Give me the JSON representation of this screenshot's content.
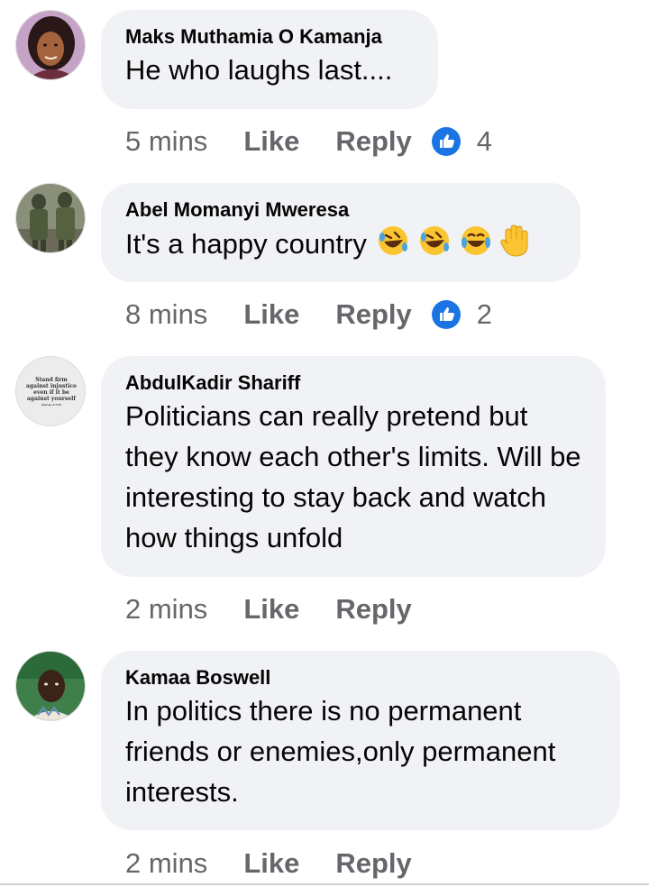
{
  "comments": [
    {
      "author": "Maks Muthamia O Kamanja",
      "text": "He who laughs last....",
      "time": "5 mins",
      "like_label": "Like",
      "reply_label": "Reply",
      "reaction_count": "4"
    },
    {
      "author": "Abel Momanyi Mweresa",
      "text": "It's a happy country",
      "emojis": [
        "rofl-emoji-icon",
        "rofl-emoji-icon",
        "joy-emoji-icon",
        "raised-hand-emoji-icon"
      ],
      "time": "8 mins",
      "like_label": "Like",
      "reply_label": "Reply",
      "reaction_count": "2"
    },
    {
      "author": "AbdulKadir Shariff",
      "avatar_text": "Stand firm against injustice even if it be against yourself",
      "avatar_ref": "Qur'an 4:135",
      "text": "Politicians can really pretend but they know each other's limits. Will be interesting to stay back and watch how things unfold",
      "time": "2 mins",
      "like_label": "Like",
      "reply_label": "Reply"
    },
    {
      "author": "Kamaa Boswell",
      "text": "In politics there is no permanent friends or enemies,only permanent interests.",
      "time": "2 mins",
      "like_label": "Like",
      "reply_label": "Reply"
    }
  ],
  "colors": {
    "bubble": "#f0f2f5",
    "meta_text": "#65676b",
    "like_blue": "#1b74e4",
    "emoji_yellow": "#fbc531"
  }
}
